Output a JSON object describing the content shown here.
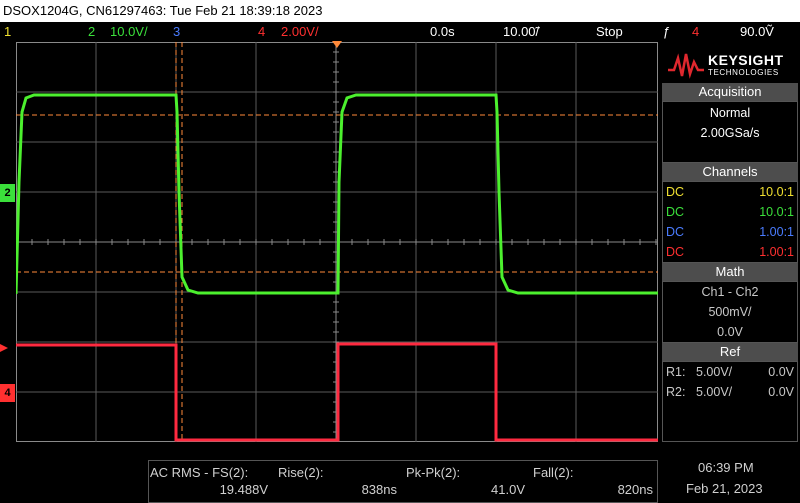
{
  "title": "DSOX1204G, CN61297463: Tue Feb 21 18:39:18 2023",
  "status": {
    "ch1_num": "1",
    "ch2_num": "2",
    "ch2_scale": "10.0V/",
    "ch3_num": "3",
    "ch4_num": "4",
    "ch4_scale": "2.00V/",
    "time_offset": "0.0s",
    "time_scale": "10.00̃/",
    "run_state": "Stop",
    "trigger_source": "4",
    "trigger_level": "90.0Ṽ"
  },
  "side": {
    "brand": "KEYSIGHT",
    "brand_sub": "TECHNOLOGIES",
    "acquisition": {
      "heading": "Acquisition",
      "mode": "Normal",
      "rate": "2.00GSa/s"
    },
    "channels": {
      "heading": "Channels",
      "rows": [
        {
          "coupling": "DC",
          "probe": "10.0:1",
          "color": "#f0e030"
        },
        {
          "coupling": "DC",
          "probe": "10.0:1",
          "color": "#3be03b"
        },
        {
          "coupling": "DC",
          "probe": "1.00:1",
          "color": "#4a7cff"
        },
        {
          "coupling": "DC",
          "probe": "1.00:1",
          "color": "#ff3030"
        }
      ]
    },
    "math": {
      "heading": "Math",
      "function": "Ch1 - Ch2",
      "scale": "500mV/",
      "offset": "0.0V"
    },
    "ref": {
      "heading": "Ref",
      "rows": [
        {
          "name": "R1:",
          "scale": "5.00V/",
          "offset": "0.0V"
        },
        {
          "name": "R2:",
          "scale": "5.00V/",
          "offset": "0.0V"
        }
      ]
    }
  },
  "markers": {
    "ch2": "2",
    "ch4": "4"
  },
  "measurements": [
    {
      "label": "AC RMS - FS(2):",
      "value": "19.488V"
    },
    {
      "label": "Rise(2):",
      "value": "838ns"
    },
    {
      "label": "Pk-Pk(2):",
      "value": "41.0V"
    },
    {
      "label": "Fall(2):",
      "value": "820ns"
    }
  ],
  "clock": {
    "time": "06:39 PM",
    "date": "Feb 21, 2023"
  },
  "colors": {
    "ch1": "#f0e030",
    "ch2": "#3be03b",
    "ch3": "#4a7cff",
    "ch4": "#ff3030",
    "cursor": "#ff8a3a"
  }
}
